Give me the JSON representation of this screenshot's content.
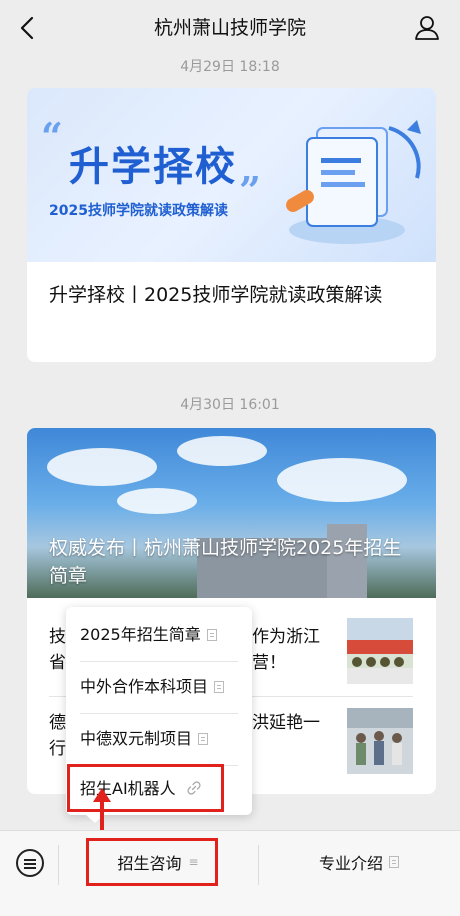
{
  "header": {
    "title": "杭州萧山技师学院"
  },
  "articles": [
    {
      "time": "4月29日 18:18",
      "banner": {
        "title": "升学择校",
        "subtitle": "2025技师学院就读政策解读"
      },
      "text": "升学择校丨2025技师学院就读政策解读"
    },
    {
      "time": "4月30日 16:01",
      "banner": {
        "title": "权威发布丨杭州萧山技师学院2025年招生简章"
      },
      "rows": [
        {
          "line1": "技",
          "line1b": "作为浙江",
          "line2": "省",
          "line2b": "营！"
        },
        {
          "line1": "德",
          "line1b": "洪延艳一",
          "line2": "行",
          "line2b": ""
        }
      ]
    }
  ],
  "popup": {
    "items": [
      {
        "label": "2025年招生简章",
        "icon": "doc-icon"
      },
      {
        "label": "中外合作本科项目",
        "icon": "doc-icon"
      },
      {
        "label": "中德双元制项目",
        "icon": "doc-icon"
      },
      {
        "label": "招生AI机器人",
        "icon": "link-icon"
      }
    ]
  },
  "bottom_menu": {
    "left": "招生咨询",
    "right": "专业介绍"
  },
  "colors": {
    "annotation": "#e0211c",
    "brand_blue": "#1f5fd1"
  }
}
